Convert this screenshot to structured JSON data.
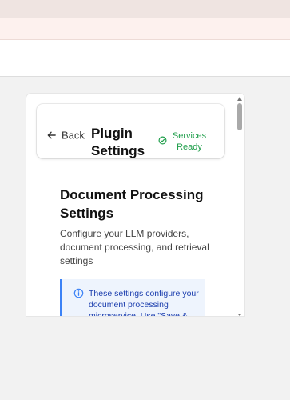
{
  "header": {
    "back_label": "Back",
    "title": "Plugin Settings",
    "status_text": "Services Ready"
  },
  "main": {
    "section_title": "Document Processing Settings",
    "section_description": "Configure your LLM providers, document processing, and retrieval settings",
    "info_text": "These settings configure your document processing microservice. Use \"Save & Apply\" to update the service."
  },
  "icons": {
    "back": "arrow-left-icon",
    "status": "check-circle-icon",
    "info": "info-circle-icon"
  },
  "colors": {
    "status_green": "#1e9e4a",
    "info_blue": "#3b82f6",
    "info_text": "#1e40af"
  }
}
